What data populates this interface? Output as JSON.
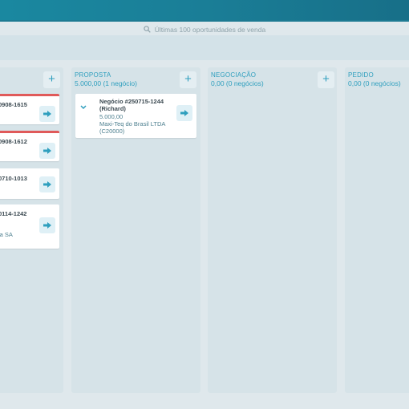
{
  "search": {
    "placeholder": "Últimas 100 oportunidades de venda"
  },
  "columns": [
    {
      "id": "col0",
      "cards": [
        {
          "title": "0908-1615",
          "flag": true
        },
        {
          "title": "0908-1612",
          "flag": true
        },
        {
          "title": "0710-1013",
          "flag": false
        },
        {
          "title": "0114-1242",
          "line": "ia SA",
          "flag": false
        }
      ]
    },
    {
      "id": "proposta",
      "title": "PROPOSTA",
      "subtitle": "5.000,00 (1 negócio)",
      "cards": [
        {
          "title": "Negócio #250715-1244",
          "title2": "(Richard)",
          "value": "5.000,00",
          "company": "Maxi-Teq do Brasil LTDA",
          "code": "(C20000)"
        }
      ]
    },
    {
      "id": "negociacao",
      "title": "NEGOCIAÇÃO",
      "subtitle": "0,00 (0 negócios)",
      "cards": []
    },
    {
      "id": "pedido",
      "title": "PEDIDO",
      "subtitle": "0,00 (0 negócios)",
      "cards": []
    }
  ],
  "icons": {
    "search": "search-icon",
    "add": "plus-icon",
    "open": "arrow-right-icon",
    "expand": "chevron-down-icon"
  },
  "colors": {
    "accent": "#2f9fbe",
    "flag": "#e05a5a",
    "topbar": "#1a7e97",
    "board": "#d6e3e8"
  }
}
